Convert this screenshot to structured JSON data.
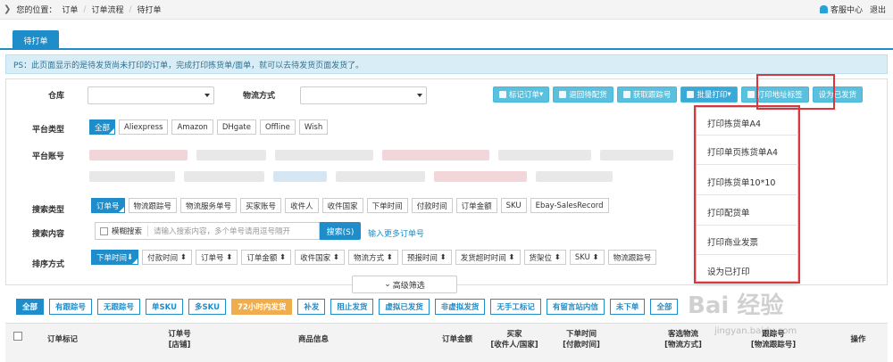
{
  "topbar": {
    "location_label": "您的位置：",
    "crumbs": [
      "订单",
      "订单流程",
      "待打单"
    ],
    "service": "客服中心",
    "logout": "退出"
  },
  "tab": {
    "label": "待打单"
  },
  "notice": "PS：此页面显示的是待发货尚未打印的订单，完成打印拣货单/面单，就可以去待发货页面发货了。",
  "filters": {
    "warehouse_label": "仓库",
    "logistics_label": "物流方式",
    "platform_type_label": "平台类型",
    "platform_types": [
      "全部",
      "Aliexpress",
      "Amazon",
      "DHgate",
      "Offline",
      "Wish"
    ],
    "platform_account_label": "平台账号",
    "search_type_label": "搜索类型",
    "search_types": [
      "订单号",
      "物流跟踪号",
      "物流服务单号",
      "买家账号",
      "收件人",
      "收件国家",
      "下单时间",
      "付款时间",
      "订单金额",
      "SKU",
      "Ebay-SalesRecord"
    ],
    "search_content_label": "搜索内容",
    "fuzzy_label": "模糊搜索",
    "search_placeholder": "请输入搜索内容，多个单号请用逗号隔开",
    "search_button": "搜索(S)",
    "more_link": "输入更多订单号",
    "sort_label": "排序方式",
    "sort_options": [
      "下单时间",
      "付款时间",
      "订单号",
      "订单金额",
      "收件国家",
      "物流方式",
      "预报时间",
      "发货超时时间",
      "货架位",
      "SKU",
      "物流跟踪号"
    ],
    "advanced": "高级筛选"
  },
  "actions": [
    "标记订单",
    "退回待配货",
    "获取跟踪号",
    "批量打印",
    "打印地址标签",
    "设为已发货"
  ],
  "print_menu": [
    "打印拣货单A4",
    "打印单页拣货单A4",
    "打印拣货单10*10",
    "打印配货单",
    "打印商业发票",
    "设为已打印"
  ],
  "order_tabs": [
    "全部",
    "有跟踪号",
    "无跟踪号",
    "单SKU",
    "多SKU",
    "72小时内发货",
    "补发",
    "阻止发货",
    "虚拟已发货",
    "非虚拟发货",
    "无手工标记",
    "有留言站内信",
    "未下单",
    "全部"
  ],
  "table_headers": [
    "订单标记",
    "订单号\n[店铺]",
    "商品信息",
    "订单金额",
    "买家\n[收件人/国家]",
    "下单时间\n[付款时间]",
    "客选物流\n[物流方式]",
    "跟踪号\n[物流跟踪号]",
    "操作"
  ],
  "watermark": "Bai 经验",
  "watermark_url": "jingyan.baidu.com"
}
